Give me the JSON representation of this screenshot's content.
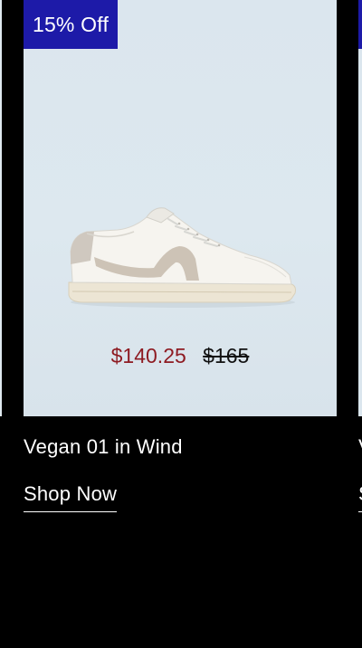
{
  "card": {
    "badge": "15% Off",
    "sale_price": "$140.25",
    "original_price": "$165",
    "name": "Vegan 01 in Wind",
    "cta": "Shop Now",
    "image_icon": "sneaker-image",
    "colors": {
      "badge_bg": "#1d1aa8",
      "sale_price": "#8e1b22",
      "image_bg": "#dbe6ee"
    }
  },
  "next_card": {
    "name": "V",
    "cta": "S"
  }
}
